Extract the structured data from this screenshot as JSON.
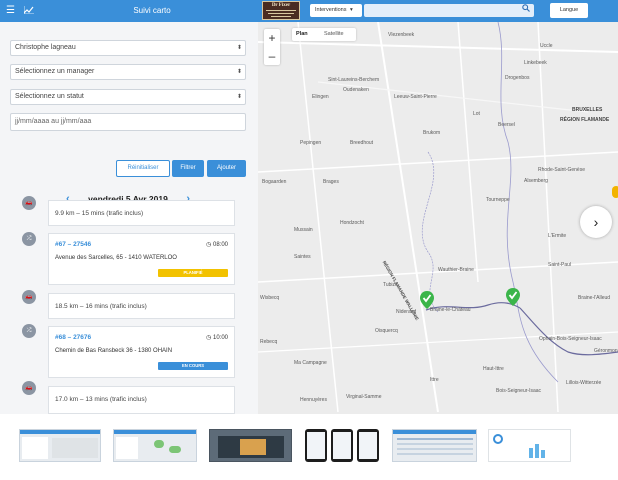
{
  "header": {
    "title": "Suivi carto",
    "menu_icon": "hamburger-icon",
    "chart_icon": "line-chart-icon",
    "dropdown": "Interventions",
    "search_placeholder": "",
    "language": "Langue",
    "logo_text": "Dr Fixer"
  },
  "filters": {
    "technician": "Christophe lagneau",
    "manager": "Sélectionnez un manager",
    "status": "Sélectionnez un statut",
    "date_placeholder": "jj/mm/aaaa au jj/mm/aaa"
  },
  "buttons": {
    "reset": "Réinitialiser",
    "filter": "Filtrer",
    "add": "Ajouter"
  },
  "day": {
    "label": "vendredi 5 Avr 2019"
  },
  "timeline": {
    "travel1": "9.9 km – 15 mins (trafic inclus)",
    "inter1": {
      "ref": "#67 – 27546",
      "time": "08:00",
      "address": "Avenue des Sarcelles, 65 - 1410 WATERLOO",
      "status": "PLANIFIÉ",
      "status_color": "#f2c200"
    },
    "travel2": "18.5 km – 16 mins (trafic inclus)",
    "inter2": {
      "ref": "#68 – 27676",
      "time": "10:00",
      "address": "Chemin de Bas Ransbeck 36 - 1380 OHAIN",
      "status": "EN COURS",
      "status_color": "#3a8fd9"
    },
    "travel3": "17.0 km – 13 mins (trafic inclus)"
  },
  "map": {
    "zoom_in": "+",
    "zoom_out": "–",
    "type_plan": "Plan",
    "type_satellite": "Satellite",
    "labels": {
      "vlezenbeek": "Vlezenbeek",
      "uccle": "Uccle",
      "drogenbos": "Drogenbos",
      "sint_laureins": "Sint-Laureins-Berchem",
      "linkebeek": "Linkebeek",
      "elingen": "Elingen",
      "oudenaken": "Oudenaken",
      "leeuw": "Leeuw-Saint-Pierre",
      "bruxelles": "BRUXELLES",
      "region_flamande": "RÉGION FLAMANDE",
      "lot": "Lot",
      "beersel": "Beersel",
      "pepingen": "Pepingen",
      "breedhout": "Breedhout",
      "brukom": "Brukom",
      "rhode": "Rhode-Saint-Genèse",
      "alsemberg": "Alsemberg",
      "bogaarden": "Bogaarden",
      "braine_alleud": "Braine-l'Alleud",
      "brages": "Brages",
      "tourneppe": "Tourneppe",
      "hondzocht": "Hondzocht",
      "lembeek": "Lembeek",
      "mussain": "Mussain",
      "lermite": "L'Ermite",
      "saintes": "Saintes",
      "wauthier_braine": "Wauthier-Braine",
      "saint_paul": "Saint-Paul",
      "region_wallonie": "RÉGION FLAMANDE WALLONIE",
      "tubize": "Tubize",
      "wisbecq": "Wisbecq",
      "niderand": "Niderand",
      "braine_le_chateau": "Braine-le-Château",
      "braine_l_alleud_right": "Braine-l'Alleud",
      "oisquercq": "Oisquercq",
      "rebecq": "Rebecq",
      "ophain": "Ophain-Bois-Seigneur-Isaac",
      "ma_campagne": "Ma Campagne",
      "haut_ittre": "Haut-Ittre",
      "lillois": "Lillois-Witterzée",
      "ittre": "Ittre",
      "virginal": "Virginal-Samme",
      "hennuyeres": "Hennuyères",
      "bois_seigneur": "Bois-Seigneur-Isaac",
      "geronmon": "Géronmon"
    },
    "next_label": "›"
  },
  "thumbnails": [
    "map",
    "heatmap",
    "desktop",
    "mobile",
    "table",
    "dashboard"
  ]
}
